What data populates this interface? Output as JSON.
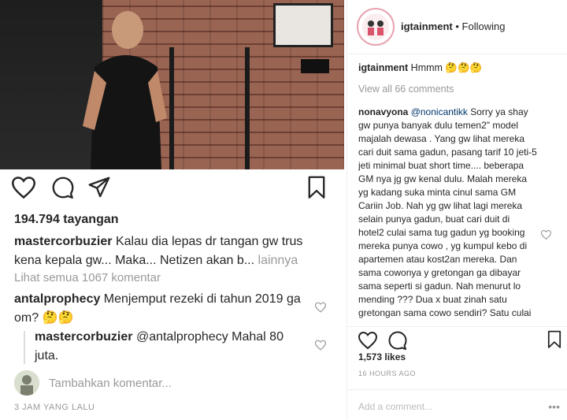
{
  "left": {
    "views": "194.794 tayangan",
    "caption": {
      "user": "mastercorbuzier",
      "text": " Kalau dia lepas dr tangan gw trus kena kepala gw... Maka... Netizen akan b...",
      "more": " lainnya"
    },
    "view_all": "Lihat semua 1067 komentar",
    "comments": [
      {
        "user": "antalprophecy",
        "text": " Menjemput rezeki di tahun 2019 ga om? 🤔🤔"
      },
      {
        "user": "mastercorbuzier",
        "text": " @antalprophecy Mahal 80 juta."
      }
    ],
    "add_comment_placeholder": "Tambahkan komentar...",
    "timestamp": "3 JAM YANG LALU"
  },
  "right": {
    "handle": "igtainment",
    "follow_status": "• Following",
    "caption": {
      "user": "igtainment",
      "text": " Hmmm 🤔🤔🤔"
    },
    "view_all": "View all 66 comments",
    "comment": {
      "user": "nonavyona",
      "mention": " @nonicantikk",
      "text": " Sorry ya shay gw punya banyak dulu temen2\" model majalah dewasa . Yang gw lihat mereka cari duit sama gadun, pasang tarif 10 jeti-5 jeti minimal buat short time.... beberapa GM nya jg gw kenal dulu. Malah mereka yg kadang suka minta cinul sama GM Cariin Job. Nah yg gw lihat lagi mereka selain punya gadun, buat cari duit di hotel2 culai sama tug gadun yg booking mereka punya cowo , yg kumpul kebo di apartemen atau kost2an mereka. Dan sama cowonya y gretongan ga dibayar sama seperti si gadun. Nah menurut lo mending ??? Dua x buat zinah satu gretongan sama cowo sendiri? Satu culai sama gadun."
    },
    "likes": "1,573 likes",
    "timestamp": "16 HOURS AGO",
    "add_comment_placeholder": "Add a comment...",
    "more_icon_text": "•••"
  }
}
